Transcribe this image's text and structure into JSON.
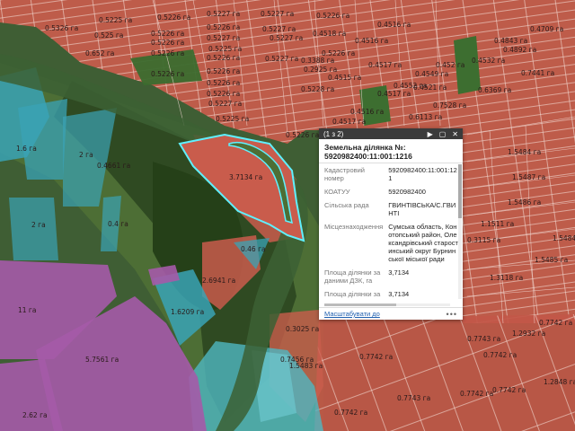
{
  "colors": {
    "parcel_red": "#c95c4c",
    "parcel_teal": "#3aa3b5",
    "parcel_purple": "#a55aa8",
    "selection": "#5ff0ff"
  },
  "map": {
    "labels": [
      "0.5225 га",
      "0.5226 га",
      "0.5227 га",
      "0.5227 га",
      "0.5226 га",
      "0.4516 га",
      "0.5326 га",
      "0.525 га",
      "0.5226 га",
      "0.5226 га",
      "0.5227 га",
      "0.5227 га",
      "0.4518 га",
      "0.5226 га",
      "0.5227 га",
      "0.5225 га",
      "0.4516 га",
      "0.4843 га",
      "0.4709 га",
      "0.652 га",
      "0.5226 га",
      "0.5226 га",
      "0.5227 га",
      "0.5226 га",
      "0.4892 га",
      "0.3388 га",
      "0.5226 га",
      "0.2925 га",
      "0.4517 га",
      "0.452 га",
      "0.4532 га",
      "0.5226 га",
      "0.5226 га",
      "0.4515 га",
      "0.4552 га",
      "0.4549 га",
      "0.7441 га",
      "0.5226 га",
      "0.5228 га",
      "0.4517 га",
      "0.4521 га",
      "0.6369 га",
      "0.5227 га",
      "0.7528 га",
      "1.6 га",
      "0.5225 га",
      "0.4516 га",
      "0.6113 га",
      "0.4517 га",
      "0.5226 га",
      "2 га",
      "0.4661 га",
      "1.5484 га",
      "3.7134 га",
      "1.5487 га",
      "2 га",
      "0.4 га",
      "1.5486 га",
      "1.1511 га",
      "0.3115 га",
      "1.5484 га",
      "0.46 га",
      "2.6941 га",
      "1.3118 га",
      "1.5485 га",
      "11 га",
      "1.6209 га",
      "0.3025 га",
      "0.7743 га",
      "1.2932 га",
      "0.7742 га",
      "5.7561 га",
      "0.7456 га",
      "1.5483 га",
      "0.7742 га",
      "0.7742 га",
      "1.2848 га",
      "2.62 га",
      "0.7742 га",
      "0.7743 га",
      "0.7742 га",
      "0.7742 га"
    ]
  },
  "popup": {
    "count": "(1 з 2)",
    "title": "Земельна ділянка №: 5920982400:11:001:1216",
    "fields": [
      {
        "key": "Кадастровий номер",
        "value": "5920982400:11:001:121"
      },
      {
        "key": "КОАТУУ",
        "value": "5920982400"
      },
      {
        "key": "Сільська рада",
        "value": "ГВИНТІВСЬКА/С.ГВИНТІ"
      },
      {
        "key": "Місцезнаходження",
        "value": "Сумська область, Конотопський район, Олександрівський старостинський округ Бурнинської міської ради"
      },
      {
        "key": "Площа ділянки за даними ДЗК, га",
        "value": "3,7134"
      },
      {
        "key": "Площа ділянки за даними РРП, га",
        "value": "3,7134"
      },
      {
        "key": "Площа ділянки за даними ПККУ, га",
        "value": ""
      }
    ],
    "zoom_link": "Масштабувати до",
    "more": "•••"
  }
}
